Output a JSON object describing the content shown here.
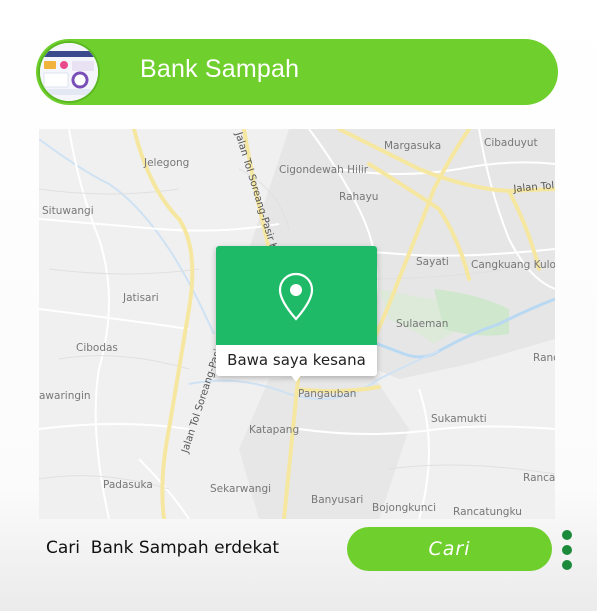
{
  "header": {
    "title": "Bank Sampah",
    "thumbnail_icon": "app-dashboard-thumbnail",
    "accent": "#6fcf2c"
  },
  "map": {
    "places": [
      "Margasuka",
      "Cibaduyut",
      "Jelegong",
      "Cigondewah Hilir",
      "Rahayu",
      "Situwangi",
      "Sayati",
      "Cangkuang Kulon",
      "Jatisari",
      "Sulaeman",
      "Cibodas",
      "Pangauban",
      "awaringin",
      "Sukamukti",
      "Katapang",
      "Padasuka",
      "Sekarwangi",
      "Banyusari",
      "Bojongkunci",
      "Rancatungku",
      "Ranc",
      "Ranca"
    ],
    "roads": [
      "Jalan Tol Soreang-Pasir Koja",
      "Jalan Tol",
      "Jalan Tol Soreang-Pasir K"
    ],
    "popup": {
      "label": "Bawa saya kesana",
      "icon": "map-pin-icon",
      "color": "#1fba68"
    }
  },
  "search": {
    "label": "Cari  Bank Sampah erdekat",
    "button_label": "Cari"
  },
  "menu": {
    "icon": "more-vertical-icon",
    "color": "#1b8a3a"
  }
}
